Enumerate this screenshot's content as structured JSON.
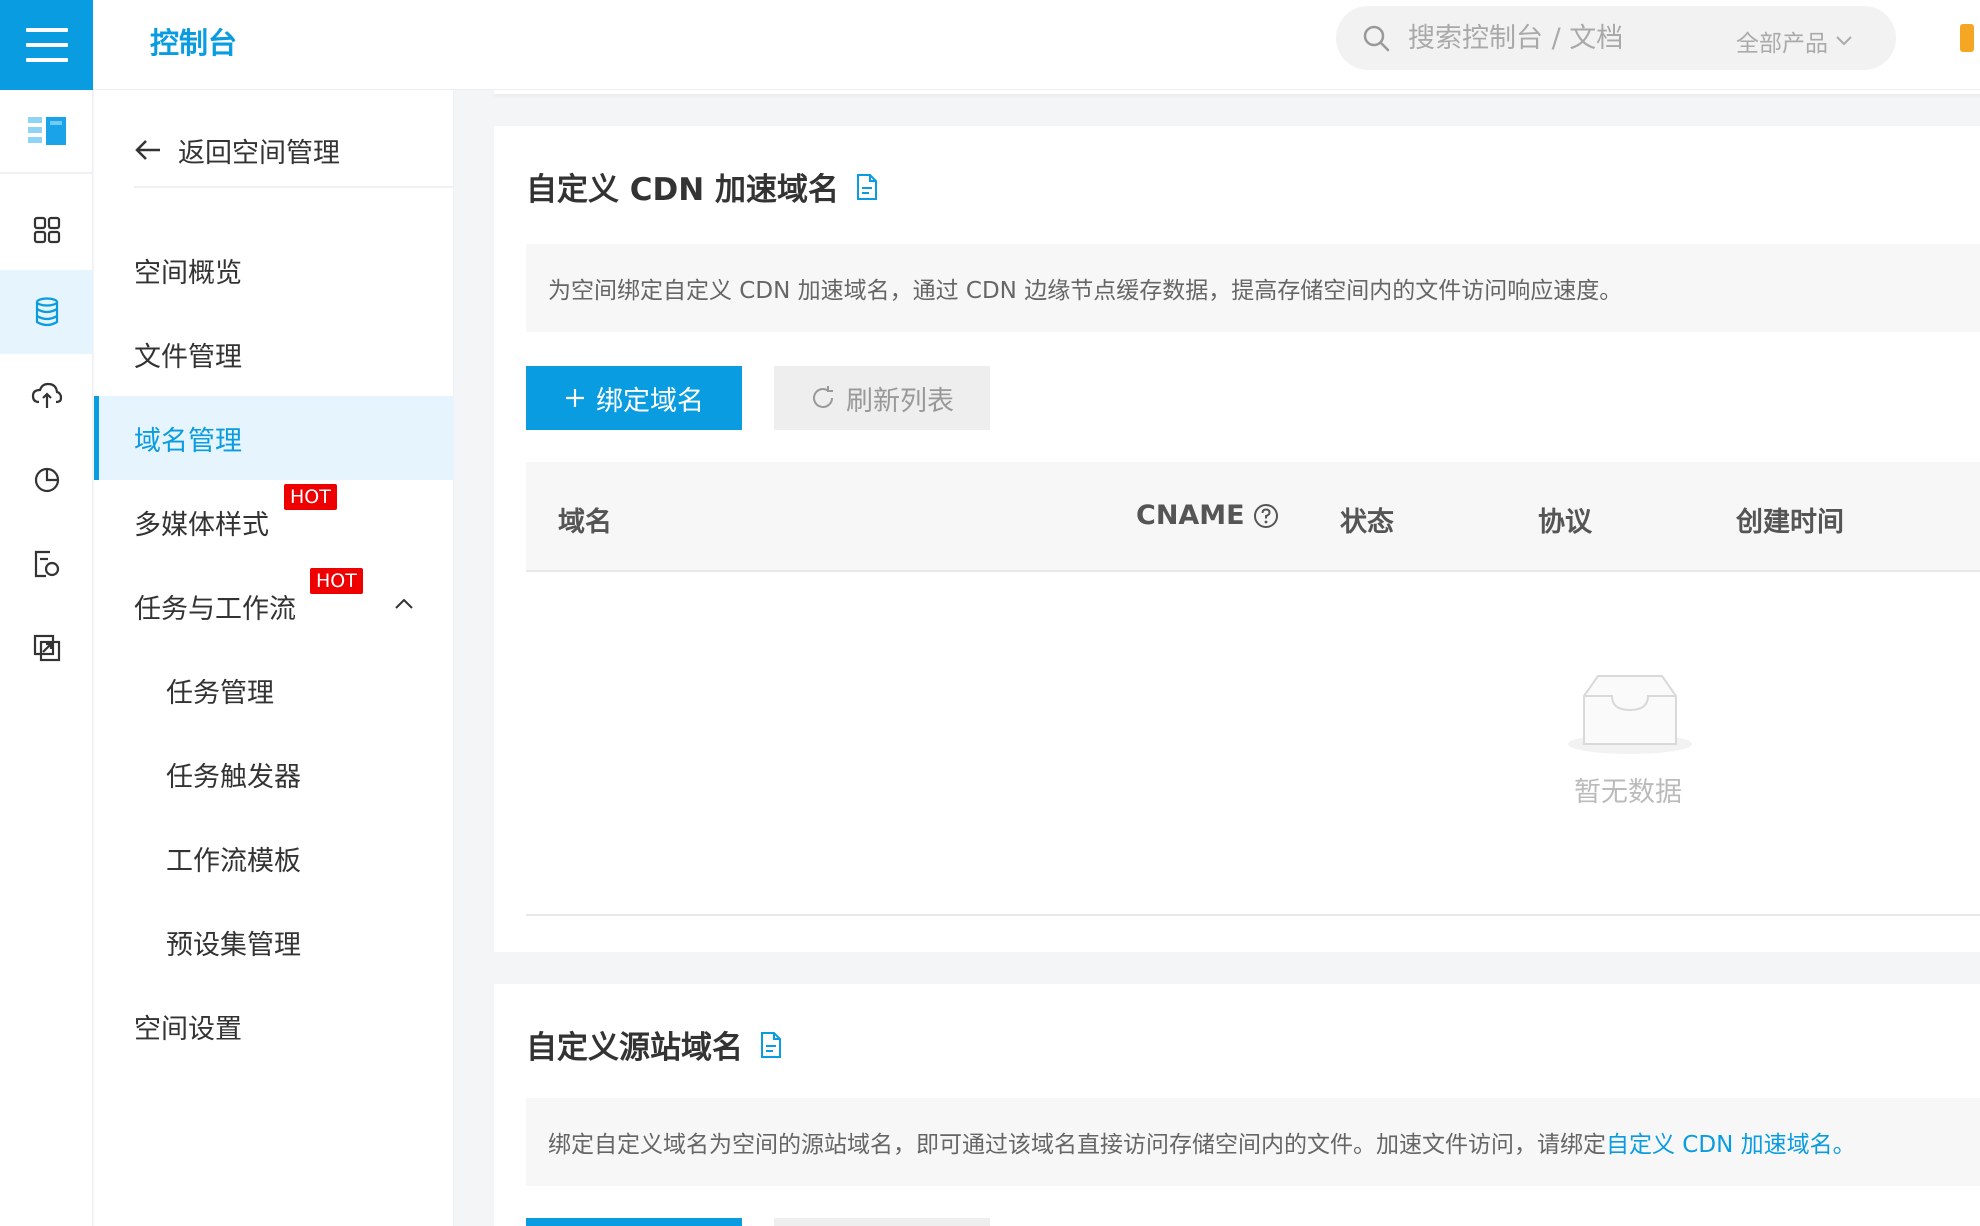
{
  "header": {
    "console_title": "控制台",
    "search_placeholder": "搜索控制台 / 文档",
    "product_filter": "全部产品"
  },
  "rail": {
    "icons": [
      "storage-logo",
      "grid-icon",
      "database-icon",
      "cloud-sync-icon",
      "pie-chart-icon",
      "file-monitor-icon",
      "transfer-icon"
    ]
  },
  "nav": {
    "back_label": "返回空间管理",
    "items": [
      {
        "label": "空间概览"
      },
      {
        "label": "文件管理"
      },
      {
        "label": "域名管理"
      },
      {
        "label": "多媒体样式",
        "badge": "HOT"
      },
      {
        "label": "任务与工作流",
        "badge": "HOT"
      },
      {
        "label": "任务管理"
      },
      {
        "label": "任务触发器"
      },
      {
        "label": "工作流模板"
      },
      {
        "label": "预设集管理"
      },
      {
        "label": "空间设置"
      }
    ]
  },
  "cdn_section": {
    "title": "自定义 CDN 加速域名",
    "description": "为空间绑定自定义 CDN 加速域名，通过 CDN 边缘节点缓存数据，提高存储空间内的文件访问响应速度。",
    "bind_button": "绑定域名",
    "refresh_button": "刷新列表",
    "columns": [
      "域名",
      "CNAME",
      "状态",
      "协议",
      "创建时间"
    ],
    "empty_text": "暂无数据"
  },
  "origin_section": {
    "title": "自定义源站域名",
    "description_prefix": "绑定自定义域名为空间的源站域名，即可通过该域名直接访问存储空间内的文件。加速文件访问，请绑定",
    "description_link": "自定义 CDN 加速域名。"
  },
  "colors": {
    "accent": "#0a9ce0",
    "hot_badge": "#ee0000",
    "active_bg": "#e6f4fd"
  }
}
